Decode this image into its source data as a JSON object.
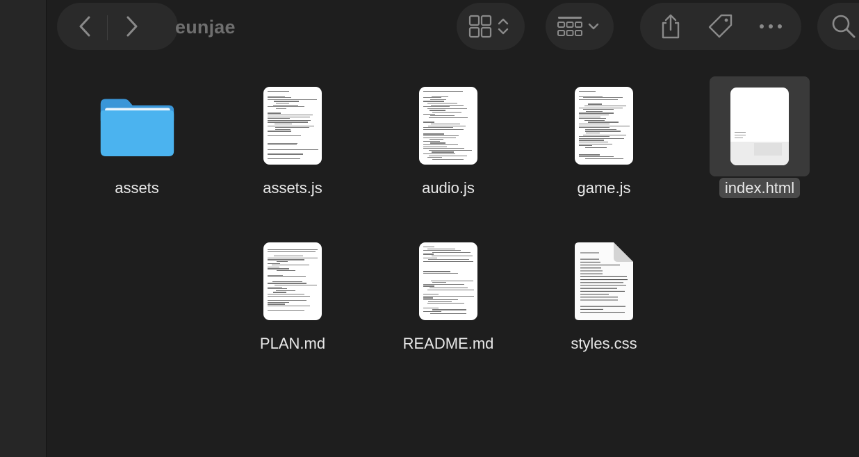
{
  "window": {
    "title": "eunjae"
  },
  "toolbar": {
    "back_icon": "chevron-left-icon",
    "forward_icon": "chevron-right-icon",
    "view_icon": "icon-grid-view-icon",
    "group_icon": "group-by-icon",
    "share_icon": "share-icon",
    "tag_icon": "tag-icon",
    "more_icon": "ellipsis-icon",
    "search_icon": "search-icon"
  },
  "files": [
    {
      "name": "assets",
      "kind": "folder"
    },
    {
      "name": "assets.js",
      "kind": "text"
    },
    {
      "name": "audio.js",
      "kind": "text"
    },
    {
      "name": "game.js",
      "kind": "text"
    },
    {
      "name": "index.html",
      "kind": "html",
      "selected": true
    },
    {
      "name": "PLAN.md",
      "kind": "text"
    },
    {
      "name": "README.md",
      "kind": "text"
    },
    {
      "name": "styles.css",
      "kind": "css"
    }
  ],
  "colors": {
    "background": "#1e1e1e",
    "folder": "#4bb3ef",
    "selection": "#3a3a3a"
  }
}
